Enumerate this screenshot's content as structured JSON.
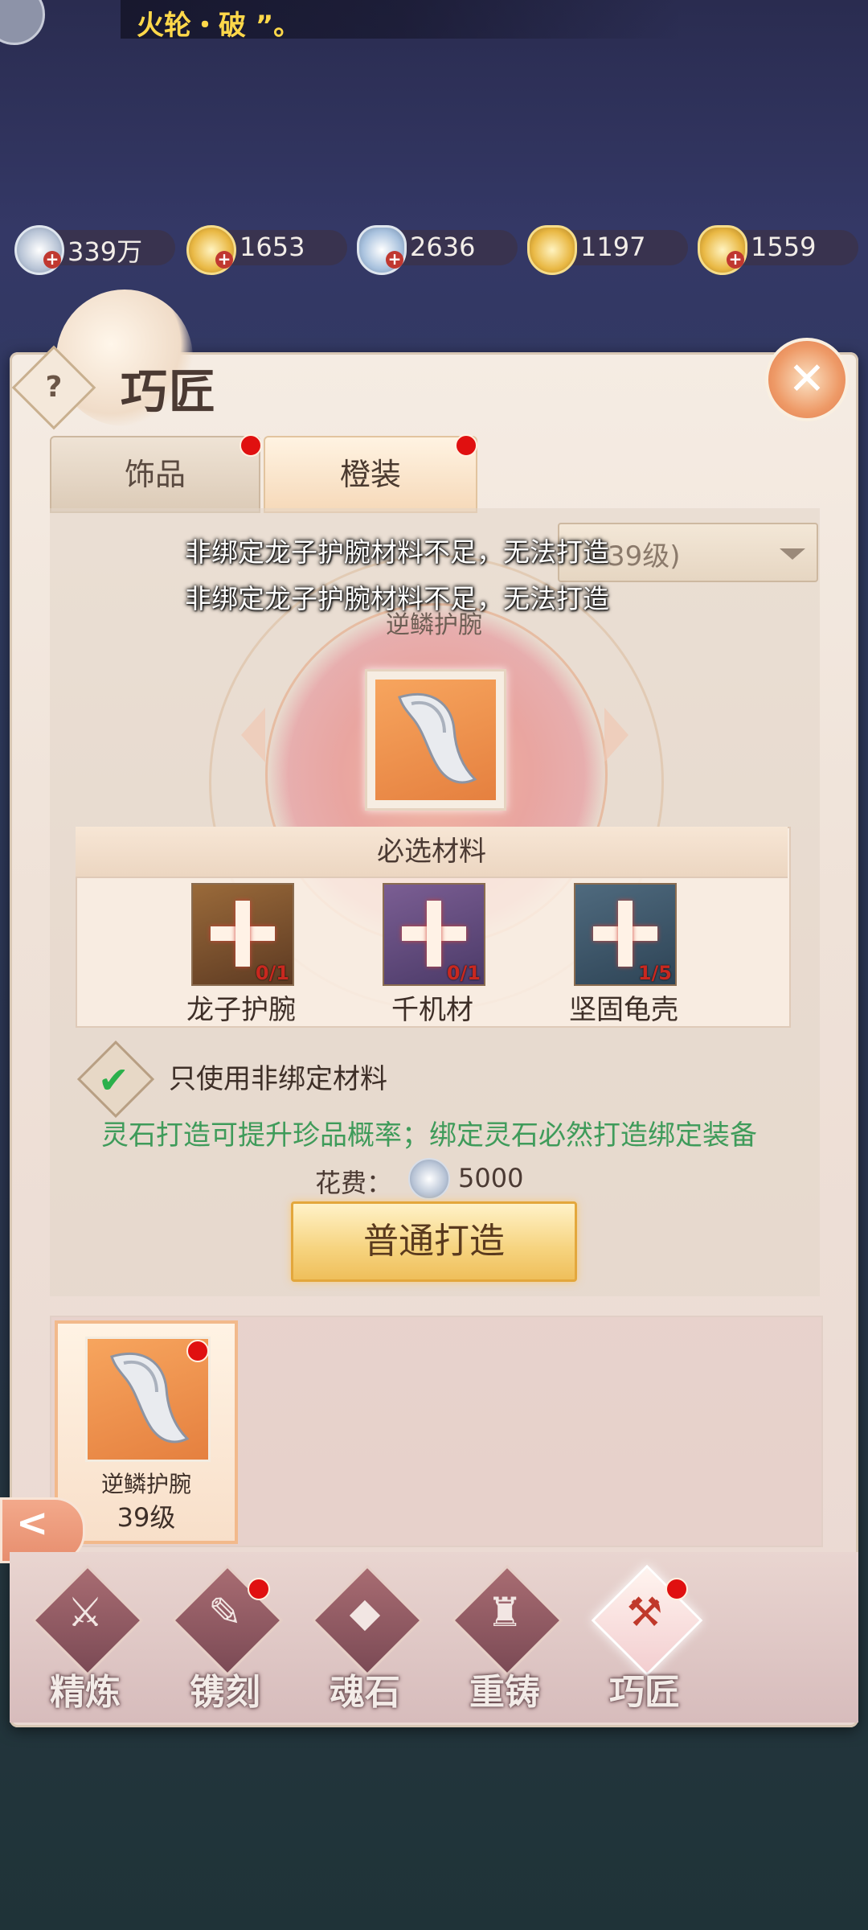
{
  "marquee": {
    "text": "火轮・破 ”。"
  },
  "currencies": [
    {
      "name": "silver-coin",
      "value": "339万",
      "color": "#c7d3e2"
    },
    {
      "name": "gold-coin",
      "value": "1653",
      "color": "#e9b844"
    },
    {
      "name": "silver-ingot",
      "value": "2636",
      "color": "#c7d3e2"
    },
    {
      "name": "locked-gold-ingot",
      "value": "1197",
      "color": "#e9b844"
    },
    {
      "name": "gold-ingot",
      "value": "1559",
      "color": "#e9b844"
    }
  ],
  "panel": {
    "title": "巧匠",
    "help": "?",
    "close": "✕"
  },
  "tabs": [
    {
      "label": "饰品",
      "badge": true
    },
    {
      "label": "橙装",
      "badge": true,
      "active": true
    }
  ],
  "dropdown": {
    "value": "39级)"
  },
  "toasts": [
    "非绑定龙子护腕材料不足，无法打造",
    "非绑定龙子护腕材料不足，无法打造"
  ],
  "target_item": {
    "name": "逆鳞护腕"
  },
  "materials": {
    "header": "必选材料",
    "items": [
      {
        "name": "龙子护腕",
        "count": "0/1"
      },
      {
        "name": "千机材",
        "count": "0/1"
      },
      {
        "name": "坚固龟壳",
        "count": "1/5"
      }
    ]
  },
  "options": {
    "unbound_only": "只使用非绑定材料",
    "checked": true,
    "hint": "灵石打造可提升珍品概率；绑定灵石必然打造绑定装备"
  },
  "cost": {
    "label": "花费：",
    "value": "5000"
  },
  "forge_button": "普通打造",
  "inventory": [
    {
      "name": "逆鳞护腕",
      "level": "39级",
      "badge": true
    }
  ],
  "back": "<",
  "bottom_nav": [
    {
      "label": "精炼",
      "badge": false
    },
    {
      "label": "镌刻",
      "badge": true
    },
    {
      "label": "魂石",
      "badge": false
    },
    {
      "label": "重铸",
      "badge": false
    },
    {
      "label": "巧匠",
      "badge": true,
      "active": true
    }
  ],
  "colors": {
    "accent_orange": "#e5803f",
    "hint_green": "#3f9b5a",
    "badge_red": "#e01010",
    "count_red": "#c8281f"
  }
}
